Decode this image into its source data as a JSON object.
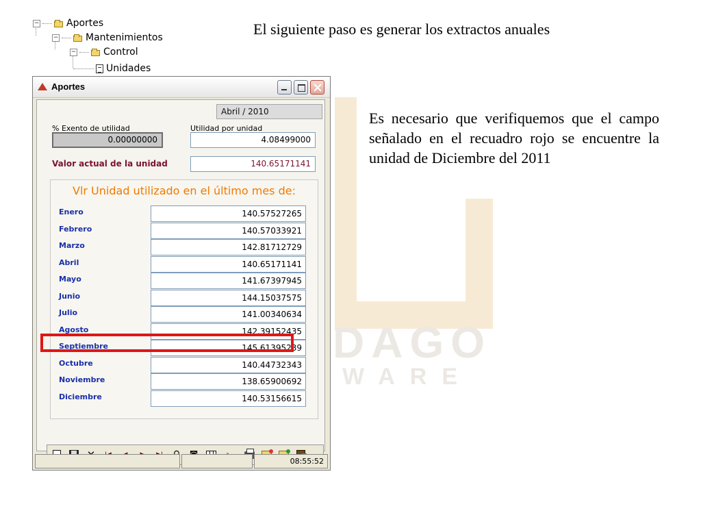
{
  "slide": {
    "title": "El siguiente paso es generar los extractos anuales",
    "body": "Es necesario que verifiquemos que el campo señalado en el recuadro rojo se encuentre la unidad de Diciembre del 2011"
  },
  "tree": {
    "items": [
      {
        "label": "Aportes",
        "toggle": "−",
        "icon": "folder-icon"
      },
      {
        "label": "Mantenimientos",
        "toggle": "−",
        "icon": "folder-icon"
      },
      {
        "label": "Control",
        "toggle": "−",
        "icon": "folder-icon"
      },
      {
        "label": "Unidades",
        "icon": "document-icon"
      }
    ]
  },
  "window": {
    "title": "Aportes",
    "period": "Abril / 2010",
    "exento_label": "% Exento de utilidad",
    "exento_value": "0.00000000",
    "utilidad_label": "Utilidad por unidad",
    "utilidad_value": "4.08499000",
    "valor_actual_label": "Valor actual de la unidad",
    "valor_actual_value": "140.65171141",
    "months_heading": "Vlr Unidad utilizado en el último mes de:",
    "months": [
      {
        "name": "Enero",
        "value": "140.57527265"
      },
      {
        "name": "Febrero",
        "value": "140.57033921"
      },
      {
        "name": "Marzo",
        "value": "142.81712729"
      },
      {
        "name": "Abril",
        "value": "140.65171141"
      },
      {
        "name": "Mayo",
        "value": "141.67397945"
      },
      {
        "name": "Junio",
        "value": "144.15037575"
      },
      {
        "name": "Julio",
        "value": "141.00340634"
      },
      {
        "name": "Agosto",
        "value": "142.39152435"
      },
      {
        "name": "Septiembre",
        "value": "145.61395239"
      },
      {
        "name": "Octubre",
        "value": "140.44732343"
      },
      {
        "name": "Noviembre",
        "value": "138.65900692"
      },
      {
        "name": "Diciembre",
        "value": "140.53156615"
      }
    ],
    "highlight_color": "#e01616",
    "status": {
      "cell1": "",
      "cell2": "",
      "cell3": "",
      "time": "08:55:52"
    },
    "toolbar": {
      "first_glyph": "I◀",
      "prev_glyph": "◀",
      "next_glyph": "▶",
      "last_glyph": "▶I",
      "close_glyph": "✕",
      "binoculars_glyph": "⚲",
      "camera_glyph": "◙"
    }
  },
  "watermark": {
    "line1": "DAGO",
    "line2": "WARE"
  }
}
